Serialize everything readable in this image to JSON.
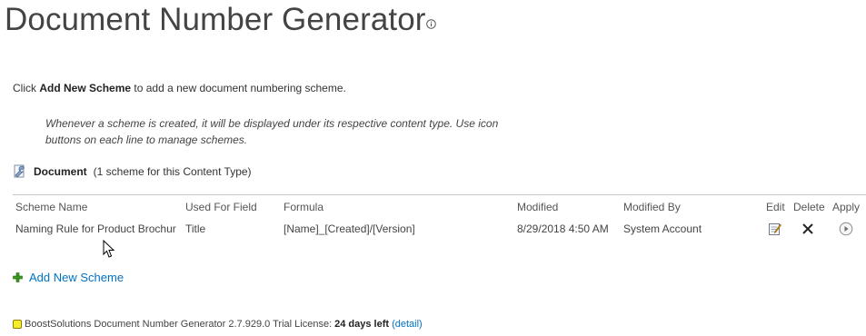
{
  "page": {
    "title": "Document Number Generator"
  },
  "intro": {
    "prefix": "Click",
    "bold": "Add New Scheme",
    "suffix": "to add a new document numbering scheme."
  },
  "hint": "Whenever a scheme is created, it will be displayed under its respective content type. Use icon buttons on each line to manage schemes.",
  "content_type": {
    "name": "Document",
    "count_text": "(1 scheme for this Content Type)"
  },
  "table": {
    "columns": [
      "Scheme Name",
      "Used For Field",
      "Formula",
      "Modified",
      "Modified By",
      "Edit",
      "Delete",
      "Apply"
    ],
    "rows": [
      {
        "scheme_name": "Naming Rule for Product Brochur",
        "used_for_field": "Title",
        "formula": "[Name]_[Created]/[Version]",
        "modified": "8/29/2018 4:50 AM",
        "modified_by": "System Account"
      }
    ]
  },
  "add_new_scheme": "Add New Scheme",
  "footer": {
    "product": "BoostSolutions Document Number Generator 2.7.929.0 Trial License:",
    "days_left": "24 days left",
    "detail_link": "(detail)"
  },
  "icons": {
    "info": "info-icon",
    "content_type": "wrench-icon",
    "edit": "edit-icon",
    "delete": "delete-icon",
    "apply": "apply-icon",
    "add": "plus-icon",
    "license": "license-icon"
  },
  "colors": {
    "link": "#0072c6",
    "add_icon": "#3a9a1e",
    "license_icon": "#f6ec2a"
  }
}
